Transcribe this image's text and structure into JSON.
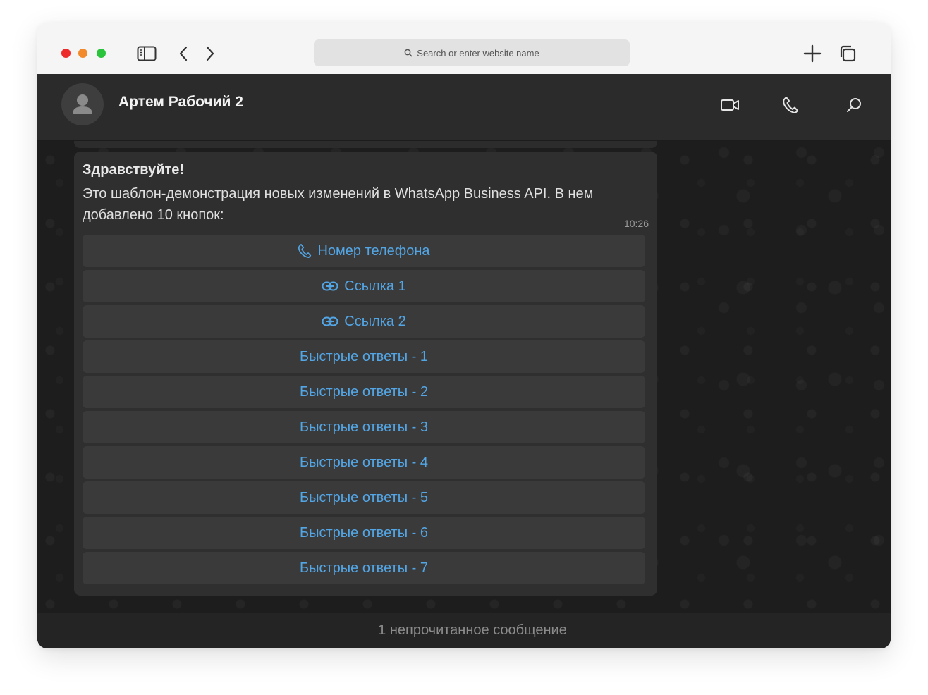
{
  "browser": {
    "address_placeholder": "Search or enter website name",
    "icons": [
      "sidebar-icon",
      "back-icon",
      "forward-icon",
      "search-icon",
      "new-tab-icon",
      "tabs-overview-icon"
    ]
  },
  "chat": {
    "contact_name": "Артем Рабочий 2",
    "header_icons": [
      "video-call-icon",
      "voice-call-icon",
      "search-icon"
    ],
    "message": {
      "title": "Здравствуйте!",
      "body": "Это шаблон-демонстрация новых изменений в WhatsApp Business API. В нем добавлено 10 кнопок:",
      "time": "10:26",
      "buttons": [
        {
          "label": "Номер телефона",
          "icon": "phone-icon"
        },
        {
          "label": "Ссылка 1",
          "icon": "link-icon"
        },
        {
          "label": "Ссылка 2",
          "icon": "link-icon"
        },
        {
          "label": "Быстрые ответы - 1"
        },
        {
          "label": "Быстрые ответы - 2"
        },
        {
          "label": "Быстрые ответы - 3"
        },
        {
          "label": "Быстрые ответы - 4"
        },
        {
          "label": "Быстрые ответы - 5"
        },
        {
          "label": "Быстрые ответы - 6"
        },
        {
          "label": "Быстрые ответы - 7"
        }
      ]
    },
    "unread_banner": "1 непрочитанное сообщение"
  },
  "colors": {
    "accent_link": "#53a6e6",
    "header_bg": "#2b2b2b",
    "bubble_bg": "#2f2f2f",
    "button_bg": "#3a3a3a"
  }
}
